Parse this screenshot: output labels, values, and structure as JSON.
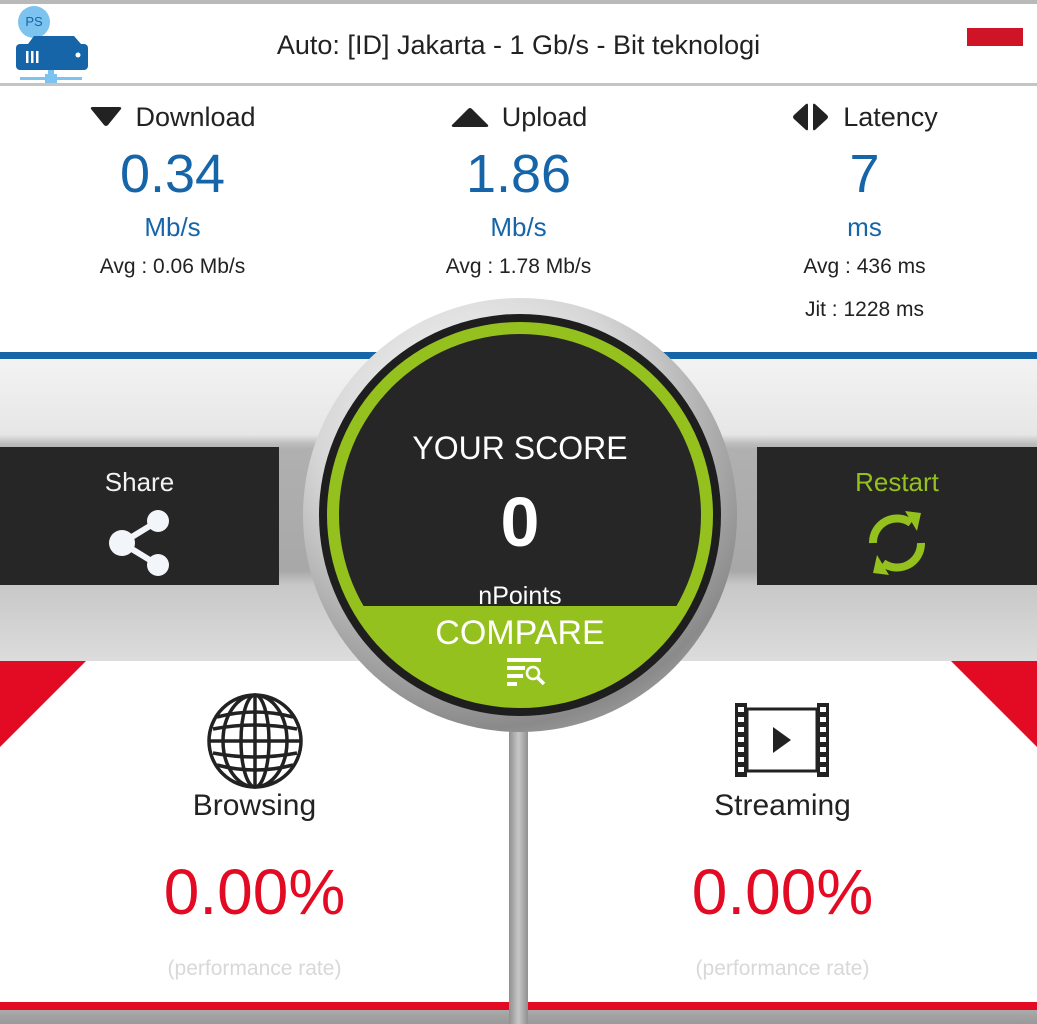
{
  "header": {
    "logo_badge": "PS",
    "logo_icon": "server-network-icon",
    "server_label": "Auto: [ID] Jakarta - 1 Gb/s - Bit teknologi",
    "flag_icon": "country-flag-icon",
    "flag_color": "#d01428"
  },
  "metrics": {
    "download": {
      "icon": "triangle-down-icon",
      "label": "Download",
      "value": "0.34",
      "unit": "Mb/s",
      "avg": "Avg : 0.06 Mb/s"
    },
    "upload": {
      "icon": "triangle-up-icon",
      "label": "Upload",
      "value": "1.86",
      "unit": "Mb/s",
      "avg": "Avg : 1.78 Mb/s"
    },
    "latency": {
      "icon": "latency-arrows-icon",
      "label": "Latency",
      "value": "7",
      "unit": "ms",
      "avg": "Avg : 436 ms",
      "jitter": "Jit : 1228 ms"
    }
  },
  "actions": {
    "share": {
      "label": "Share",
      "icon": "share-icon"
    },
    "restart": {
      "label": "Restart",
      "icon": "refresh-icon"
    }
  },
  "score": {
    "title": "YOUR SCORE",
    "value": "0",
    "unit": "nPoints",
    "compare_label": "COMPARE",
    "compare_icon": "compare-search-icon"
  },
  "cards": [
    {
      "icon": "globe-icon",
      "title": "Browsing",
      "value": "0.00%",
      "subtitle": "(performance rate)"
    },
    {
      "icon": "film-play-icon",
      "title": "Streaming",
      "value": "0.00%",
      "subtitle": "(performance rate)"
    }
  ],
  "colors": {
    "accent_blue": "#1565a8",
    "accent_green": "#95c11f",
    "accent_red": "#e30a23",
    "panel_dark": "#262626"
  }
}
